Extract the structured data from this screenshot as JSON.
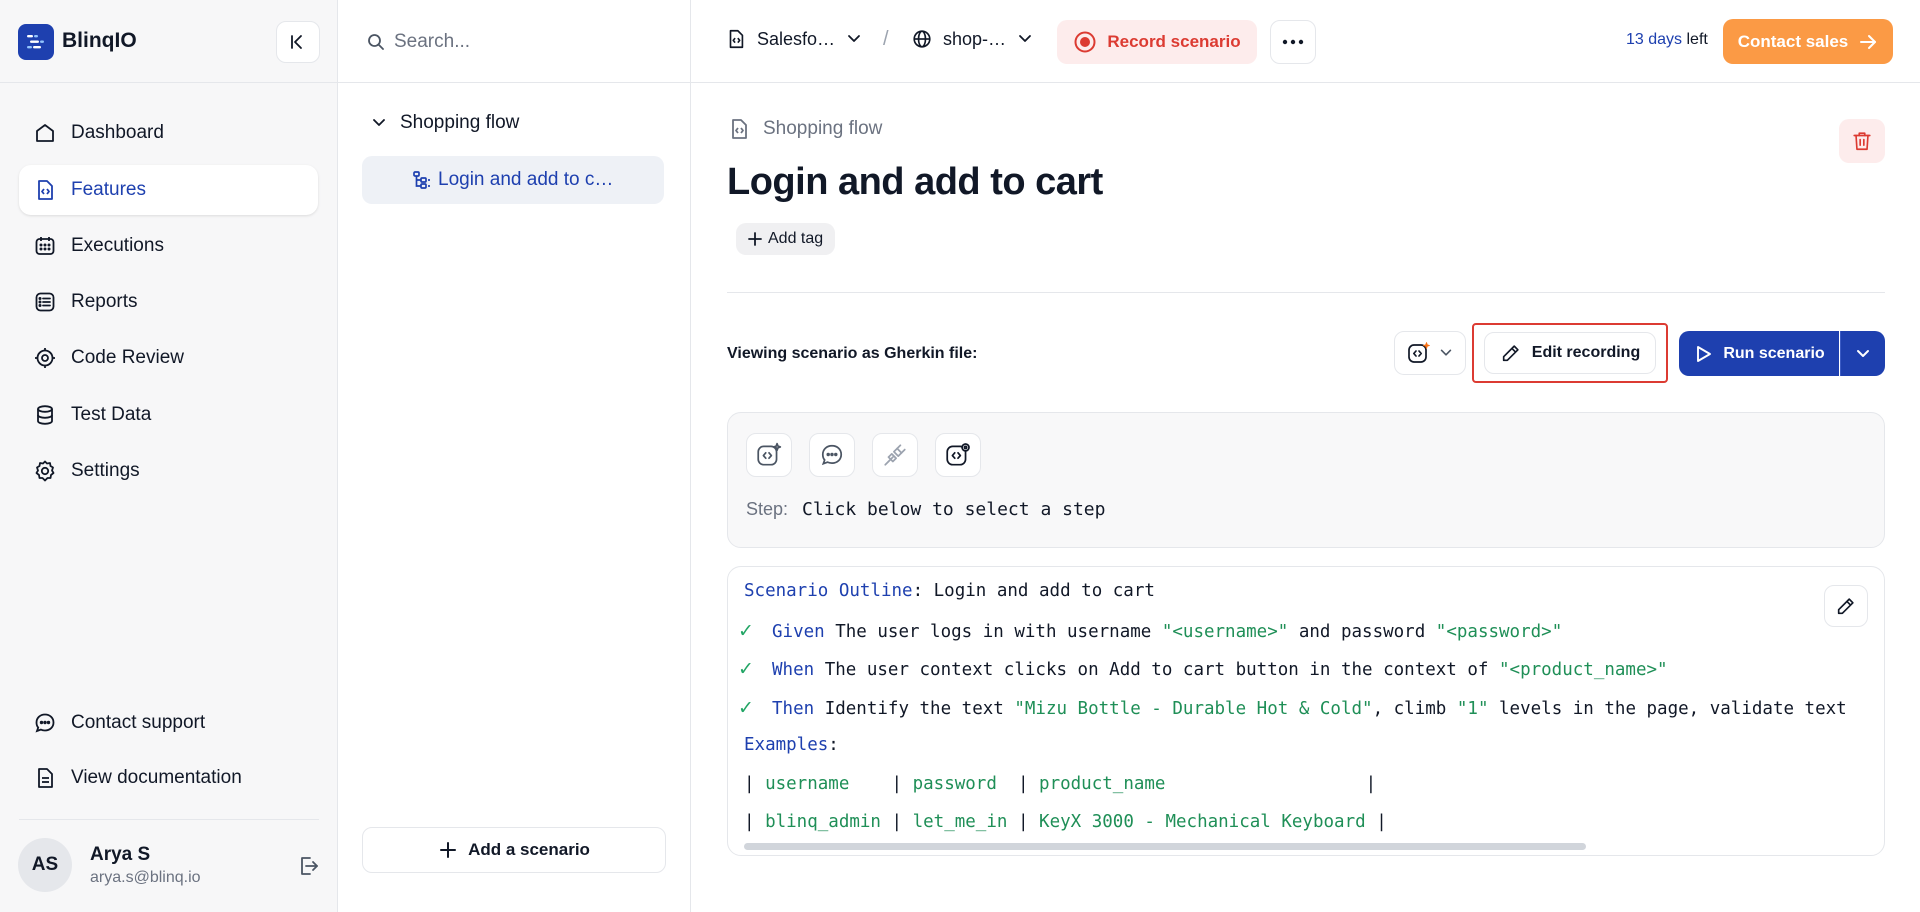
{
  "brand": {
    "name": "BlinqIO"
  },
  "nav": {
    "items": [
      {
        "label": "Dashboard",
        "icon": "home-icon",
        "active": false
      },
      {
        "label": "Features",
        "icon": "feature-file-icon",
        "active": true
      },
      {
        "label": "Executions",
        "icon": "calendar-grid-icon",
        "active": false
      },
      {
        "label": "Reports",
        "icon": "list-report-icon",
        "active": false
      },
      {
        "label": "Code Review",
        "icon": "gear-code-icon",
        "active": false
      },
      {
        "label": "Test Data",
        "icon": "database-icon",
        "active": false
      },
      {
        "label": "Settings",
        "icon": "gear-icon",
        "active": false
      }
    ],
    "bottom": [
      {
        "label": "Contact support",
        "icon": "chat-icon"
      },
      {
        "label": "View documentation",
        "icon": "document-icon"
      }
    ]
  },
  "user": {
    "initials": "AS",
    "name": "Arya S",
    "email": "arya.s@blinq.io"
  },
  "search": {
    "placeholder": "Search..."
  },
  "tree": {
    "group": "Shopping flow",
    "item": "Login and add to c…"
  },
  "add_scenario_label": "Add a scenario",
  "topbar": {
    "project": "Salesfo…",
    "environment": "shop-…",
    "record_label": "Record scenario",
    "trial_days": "13 days",
    "trial_suffix": " left",
    "contact_sales": "Contact sales"
  },
  "main": {
    "feature_name": "Shopping flow",
    "title": "Login and add to cart",
    "add_tag": "Add tag",
    "viewing_label": "Viewing scenario as Gherkin file:",
    "edit_recording": "Edit recording",
    "run_scenario": "Run scenario",
    "step_key": "Step:",
    "step_value": "Click below to select a step"
  },
  "gherkin": {
    "outline_kw": "Scenario Outline",
    "outline_title": ": Login and add to cart",
    "steps": [
      {
        "kw": "Given",
        "parts": [
          " The user logs in with username ",
          "\"<username>\"",
          " and password ",
          "\"<password>\""
        ]
      },
      {
        "kw": "When",
        "parts": [
          " The user context clicks on Add to cart button in the context of ",
          "\"<product_name>\""
        ]
      },
      {
        "kw": "Then",
        "parts": [
          " Identify the text ",
          "\"Mizu Bottle - Durable Hot & Cold\"",
          ", climb ",
          "\"1\"",
          " levels in the page, validate text"
        ]
      }
    ],
    "examples_kw": "Examples",
    "examples_colon": ":",
    "table": [
      [
        "username   ",
        "password ",
        "product_name                  "
      ],
      [
        "blinq_admin",
        "let_me_in",
        "KeyX 3000 - Mechanical Keyboard"
      ]
    ]
  },
  "colors": {
    "primary": "#1e40af",
    "accent_orange": "#fb9a45",
    "danger": "#dc3b32",
    "string_green": "#1f8f57",
    "check_green": "#22a565"
  }
}
